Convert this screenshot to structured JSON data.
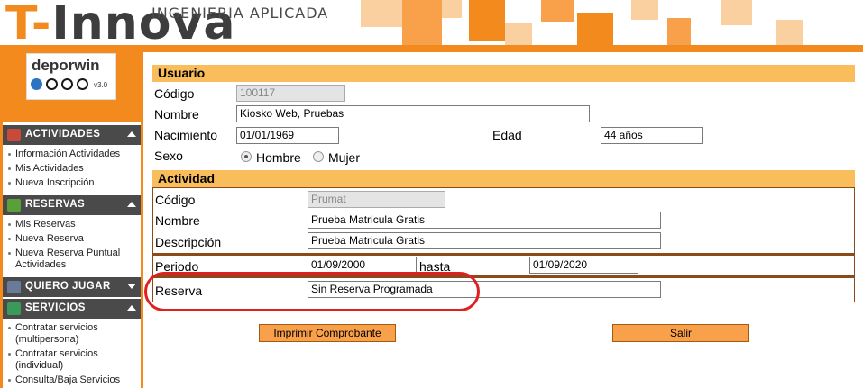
{
  "header": {
    "logo_first": "T-",
    "logo_rest": "Innova",
    "subtitle": "INGENIERIA APLICADA",
    "brand_color": "#f28a1d"
  },
  "sidebar": {
    "logo_word": "deporwin",
    "logo_version": "v3.0",
    "sections": [
      {
        "label": "ACTIVIDADES",
        "icon": "calendar-icon",
        "items": [
          "Información Actividades",
          "Mis Actividades",
          "Nueva Inscripción"
        ]
      },
      {
        "label": "RESERVAS",
        "icon": "reservation-icon",
        "items": [
          "Mis Reservas",
          "Nueva Reserva",
          "Nueva Reserva Puntual Actividades"
        ]
      },
      {
        "label": "QUIERO JUGAR",
        "icon": "magnifier-icon",
        "items": []
      },
      {
        "label": "SERVICIOS",
        "icon": "services-icon",
        "items": [
          "Contratar servicios (multipersona)",
          "Contratar servicios (individual)",
          "Consulta/Baja Servicios"
        ]
      }
    ]
  },
  "usuario": {
    "title": "Usuario",
    "codigo_label": "Código",
    "codigo_value": "100117",
    "nombre_label": "Nombre",
    "nombre_value": "Kiosko Web, Pruebas",
    "nacimiento_label": "Nacimiento",
    "nacimiento_value": "01/01/1969",
    "edad_label": "Edad",
    "edad_value": "44 años",
    "sexo_label": "Sexo",
    "sexo_options": [
      "Hombre",
      "Mujer"
    ],
    "sexo_selected": "Hombre"
  },
  "actividad": {
    "title": "Actividad",
    "codigo_label": "Código",
    "codigo_value": "Prumat",
    "nombre_label": "Nombre",
    "nombre_value": "Prueba Matricula Gratis",
    "descripcion_label": "Descripción",
    "descripcion_value": "Prueba Matricula Gratis",
    "periodo_label": "Periodo",
    "periodo_desde": "01/09/2000",
    "hasta_label": "hasta",
    "periodo_hasta": "01/09/2020",
    "reserva_label": "Reserva",
    "reserva_value": "Sin Reserva Programada"
  },
  "buttons": {
    "imprimir": "Imprimir Comprobante",
    "salir": "Salir"
  },
  "highlight_color": "#e02020"
}
